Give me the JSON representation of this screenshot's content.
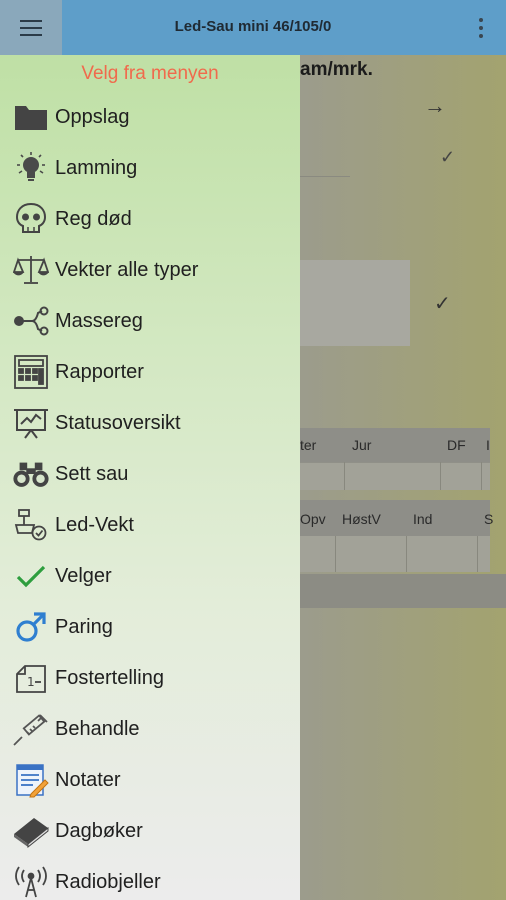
{
  "appbar": {
    "title": "Led-Sau mini 46/105/0",
    "menu_icon": "hamburger-icon",
    "overflow_icon": "more-vert-icon"
  },
  "background": {
    "header_partial": "am/mrk.",
    "table1_headers": [
      "ter",
      "Jur",
      "DF",
      "I"
    ],
    "table2_headers": [
      "Opv",
      "HøstV",
      "Ind",
      "S"
    ]
  },
  "drawer": {
    "title": "Velg fra menyen",
    "items": [
      {
        "label": "Oppslag",
        "icon": "folder-icon"
      },
      {
        "label": "Lamming",
        "icon": "lightbulb-icon"
      },
      {
        "label": "Reg død",
        "icon": "skull-icon"
      },
      {
        "label": "Vekter alle typer",
        "icon": "scales-icon"
      },
      {
        "label": "Massereg",
        "icon": "nodes-icon"
      },
      {
        "label": "Rapporter",
        "icon": "report-icon"
      },
      {
        "label": "Statusoversikt",
        "icon": "presentation-chart-icon"
      },
      {
        "label": "Sett sau",
        "icon": "binoculars-icon"
      },
      {
        "label": "Led-Vekt",
        "icon": "led-weight-icon"
      },
      {
        "label": "Velger",
        "icon": "checkmark-icon"
      },
      {
        "label": "Paring",
        "icon": "male-symbol-icon"
      },
      {
        "label": "Fostertelling",
        "icon": "ultrasound-icon"
      },
      {
        "label": "Behandle",
        "icon": "syringe-icon"
      },
      {
        "label": "Notater",
        "icon": "notes-icon"
      },
      {
        "label": "Dagbøker",
        "icon": "book-icon"
      },
      {
        "label": "Radiobjeller",
        "icon": "radio-antenna-icon"
      }
    ]
  },
  "colors": {
    "appbar": "#5e9ec9",
    "drawer_title": "#f06a4c",
    "checkmark": "#2e9e3e",
    "male_symbol": "#2f7fd0"
  }
}
